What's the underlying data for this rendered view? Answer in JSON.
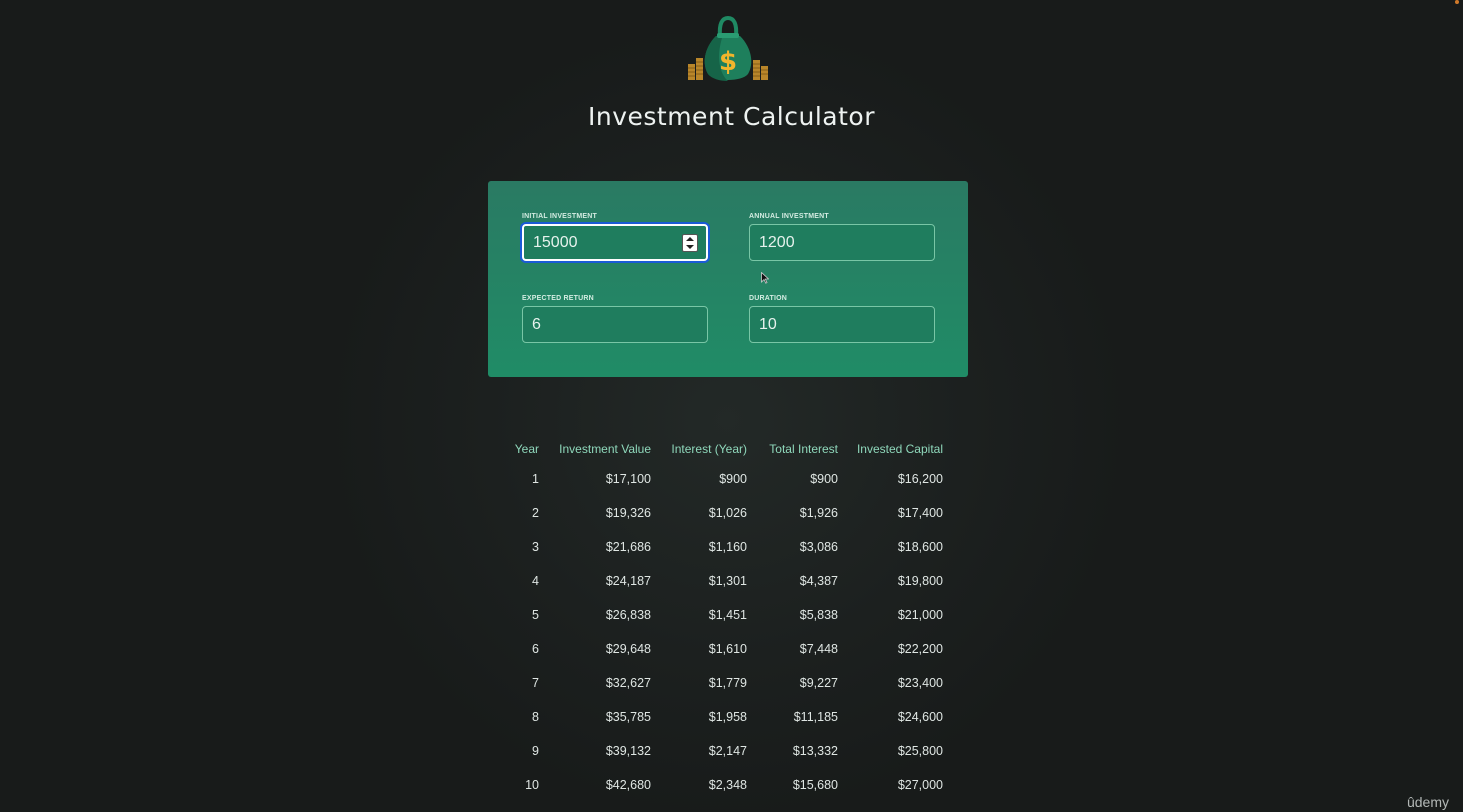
{
  "header": {
    "logo_icon": "money-bag-icon",
    "title": "Investment Calculator"
  },
  "inputs": {
    "initial_investment": {
      "label": "Initial Investment",
      "value": "15000",
      "focused": true
    },
    "annual_investment": {
      "label": "Annual Investment",
      "value": "1200"
    },
    "expected_return": {
      "label": "Expected Return",
      "value": "6"
    },
    "duration": {
      "label": "Duration",
      "value": "10"
    }
  },
  "results": {
    "columns": [
      "Year",
      "Investment Value",
      "Interest (Year)",
      "Total Interest",
      "Invested Capital"
    ],
    "rows": [
      [
        "1",
        "$17,100",
        "$900",
        "$900",
        "$16,200"
      ],
      [
        "2",
        "$19,326",
        "$1,026",
        "$1,926",
        "$17,400"
      ],
      [
        "3",
        "$21,686",
        "$1,160",
        "$3,086",
        "$18,600"
      ],
      [
        "4",
        "$24,187",
        "$1,301",
        "$4,387",
        "$19,800"
      ],
      [
        "5",
        "$26,838",
        "$1,451",
        "$5,838",
        "$21,000"
      ],
      [
        "6",
        "$29,648",
        "$1,610",
        "$7,448",
        "$22,200"
      ],
      [
        "7",
        "$32,627",
        "$1,779",
        "$9,227",
        "$23,400"
      ],
      [
        "8",
        "$35,785",
        "$1,958",
        "$11,185",
        "$24,600"
      ],
      [
        "9",
        "$39,132",
        "$2,147",
        "$13,332",
        "$25,800"
      ],
      [
        "10",
        "$42,680",
        "$2,348",
        "$15,680",
        "$27,000"
      ]
    ]
  },
  "watermark": "ûdemy",
  "colors": {
    "panel_top": "#2a7a63",
    "panel_bottom": "#208c66",
    "header_text": "#8fd8bb",
    "background": "#1c201f"
  }
}
